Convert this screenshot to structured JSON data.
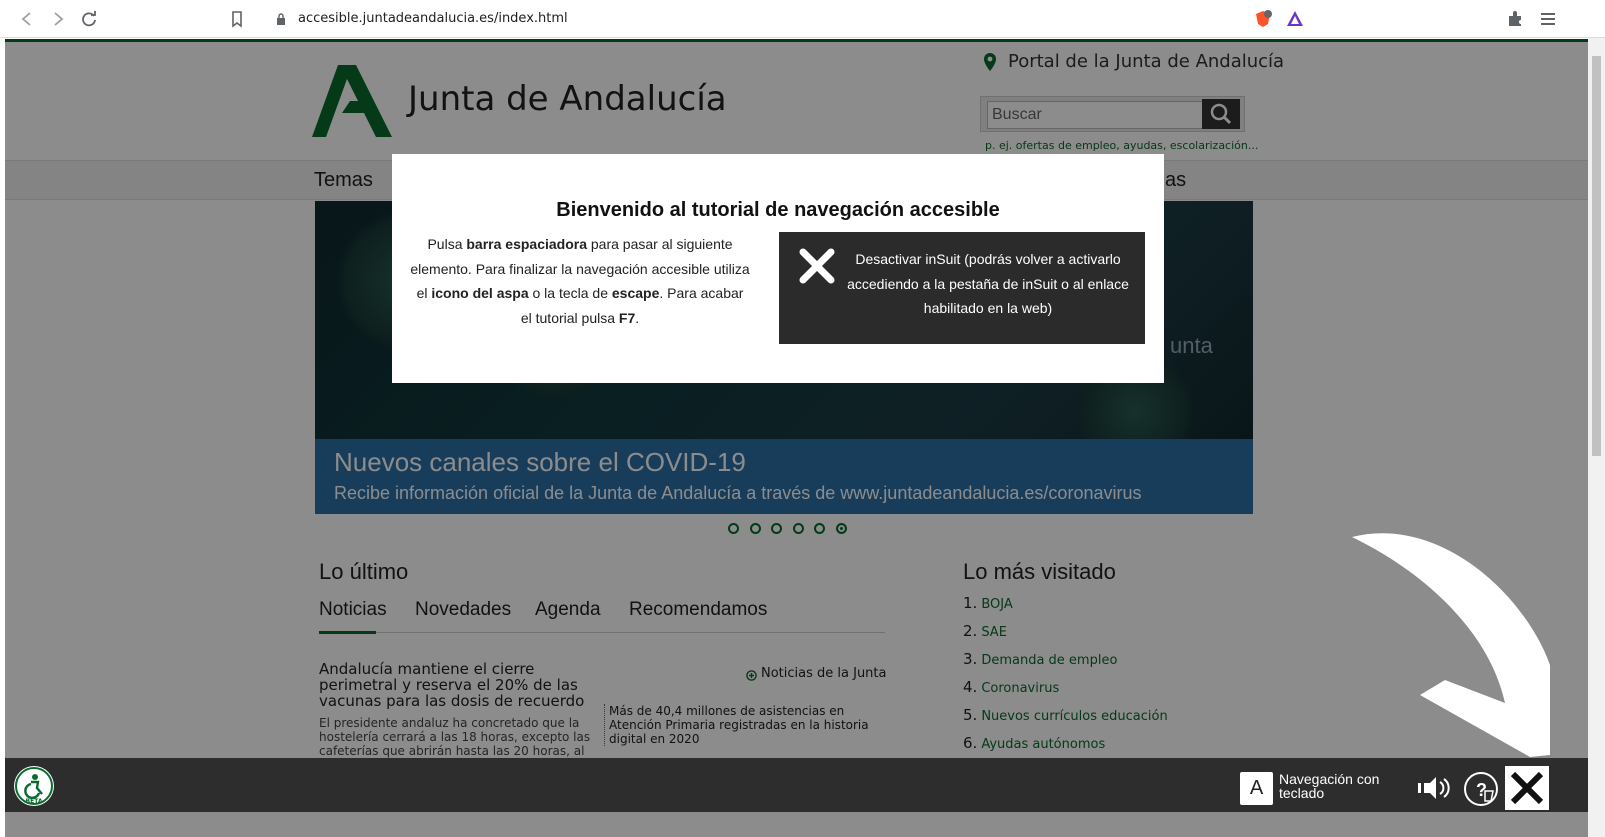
{
  "browser": {
    "url": "accesible.juntadeandalucia.es/index.html"
  },
  "site": {
    "logo_text": "Junta de Andalucía",
    "portal_link": "Portal de la Junta de Andalucía",
    "search_placeholder": "Buscar",
    "search_examples": "p. ej. ofertas de empleo, ayudas, escolarización...",
    "menu": [
      "Temas",
      "as"
    ],
    "accent_color": "#0a6b2f"
  },
  "banner": {
    "title": "Nuevos canales sobre el COVID-19",
    "subtitle": "Recibe información oficial de la Junta de Andalucía a través de www.juntadeandalucia.es/coronavirus",
    "ghost_text": "unta",
    "slide_count": 6
  },
  "latest": {
    "title": "Lo último",
    "tabs": [
      "Noticias",
      "Novedades",
      "Agenda",
      "Recomendamos"
    ],
    "news_title": "Andalucía mantiene el cierre perimetral y reserva el 20% de las vacunas para las dosis de recuerdo",
    "news_body": "El presidente andaluz ha concretado que la hostelería cerrará a las 18 horas, excepto las cafeterías que abrirán hasta las 20 horas, al",
    "news_link": "Noticias de la Junta",
    "news_side": "Más de 40,4 millones de asistencias en Atención Primaria registradas en la historia digital en 2020"
  },
  "most_visited": {
    "title": "Lo más visitado",
    "items": [
      {
        "num": "1.",
        "label": "BOJA"
      },
      {
        "num": "2.",
        "label": "SAE"
      },
      {
        "num": "3.",
        "label": "Demanda de empleo"
      },
      {
        "num": "4.",
        "label": "Coronavirus"
      },
      {
        "num": "5.",
        "label": "Nuevos currículos educación"
      },
      {
        "num": "6.",
        "label": "Ayudas autónomos"
      }
    ]
  },
  "modal": {
    "title": "Bienvenido al tutorial de navegación accesible",
    "text_1": "Pulsa ",
    "text_b1": "barra espaciadora",
    "text_2": " para pasar al siguiente elemento. Para finalizar la navegación accesible utiliza el ",
    "text_b2": "icono del aspa",
    "text_3": " o la tecla de ",
    "text_b3": "escape",
    "text_4": ". Para acabar el tutorial pulsa ",
    "text_b4": "F7",
    "text_5": ".",
    "deactivate_label": "Desactivar inSuit (podrás volver a activarlo accediendo a la pestaña de inSuit o al enlace habilitado en la web)"
  },
  "toolbar": {
    "beta_label": "BETA",
    "kbd_key": "A",
    "kbd_label_1": "Navegación con",
    "kbd_label_2": "teclado"
  }
}
